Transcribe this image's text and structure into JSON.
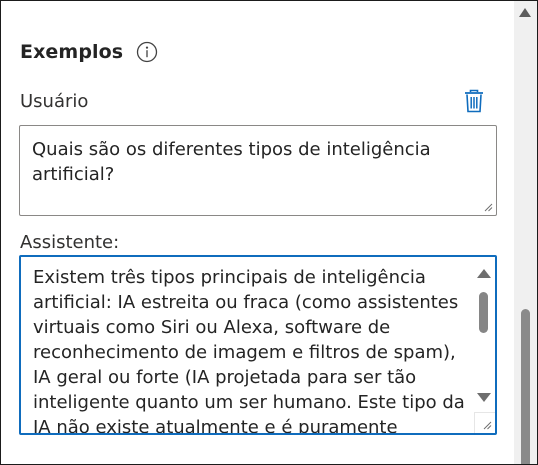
{
  "examples": {
    "title": "Exemplos",
    "info_icon": "info-circle-icon",
    "delete_icon": "trash-icon",
    "user": {
      "label": "Usuário",
      "value": "Quais são os diferentes tipos de inteligência artificial?"
    },
    "assistant": {
      "label": "Assistente:",
      "value": "Existem três tipos principais de inteligência artificial: IA estreita ou fraca (como assistentes virtuais como Siri ou Alexa, software de reconhecimento de imagem e filtros de spam), IA geral ou forte (IA projetada para ser tão inteligente quanto um ser humano. Este tipo da IA não existe atualmente e é puramente"
    }
  },
  "colors": {
    "focus_border": "#0f6cbd",
    "icon_blue": "#0f6cbd",
    "text": "#242424"
  }
}
